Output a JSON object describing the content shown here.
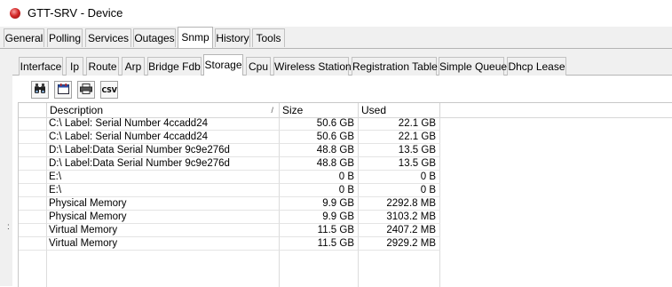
{
  "window": {
    "title": "GTT-SRV - Device"
  },
  "main_tabs": [
    {
      "label": "General"
    },
    {
      "label": "Polling"
    },
    {
      "label": "Services"
    },
    {
      "label": "Outages"
    },
    {
      "label": "Snmp",
      "active": true
    },
    {
      "label": "History"
    },
    {
      "label": "Tools"
    }
  ],
  "sub_tabs": [
    {
      "label": "Interface"
    },
    {
      "label": "Ip"
    },
    {
      "label": "Route"
    },
    {
      "label": "Arp"
    },
    {
      "label": "Bridge Fdb"
    },
    {
      "label": "Storage",
      "active": true
    },
    {
      "label": "Cpu"
    },
    {
      "label": "Wireless Station"
    },
    {
      "label": "Registration Table"
    },
    {
      "label": "Simple Queue"
    },
    {
      "label": "Dhcp Lease"
    }
  ],
  "toolbar": {
    "buttons": [
      {
        "icon": "binoculars-icon"
      },
      {
        "icon": "calendar-icon"
      },
      {
        "icon": "printer-icon"
      },
      {
        "icon": "csv-export-icon",
        "label": "CSV"
      }
    ]
  },
  "table": {
    "columns": [
      "",
      "Description",
      "Size",
      "Used"
    ],
    "sort_indicator": "/",
    "rows": [
      {
        "description": "C:\\ Label:  Serial Number 4ccadd24",
        "size": "50.6 GB",
        "used": "22.1 GB"
      },
      {
        "description": "C:\\ Label:  Serial Number 4ccadd24",
        "size": "50.6 GB",
        "used": "22.1 GB"
      },
      {
        "description": "D:\\ Label:Data  Serial Number 9c9e276d",
        "size": "48.8 GB",
        "used": "13.5 GB"
      },
      {
        "description": "D:\\ Label:Data  Serial Number 9c9e276d",
        "size": "48.8 GB",
        "used": "13.5 GB"
      },
      {
        "description": "E:\\",
        "size": "0 B",
        "used": "0 B"
      },
      {
        "description": "E:\\",
        "size": "0 B",
        "used": "0 B"
      },
      {
        "description": "Physical Memory",
        "size": "9.9 GB",
        "used": "2292.8 MB"
      },
      {
        "description": "Physical Memory",
        "size": "9.9 GB",
        "used": "3103.2 MB"
      },
      {
        "description": "Virtual Memory",
        "size": "11.5 GB",
        "used": "2407.2 MB"
      },
      {
        "description": "Virtual Memory",
        "size": "11.5 GB",
        "used": "2929.2 MB"
      }
    ]
  },
  "side_handle": ":"
}
